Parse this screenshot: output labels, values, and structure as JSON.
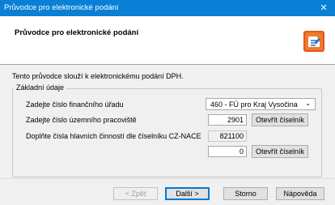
{
  "window": {
    "title": "Průvodce pro elektronické podání",
    "close_glyph": "✕"
  },
  "header": {
    "title": "Průvodce pro elektronické podání",
    "logo_icon": "wizard-logo"
  },
  "intro": "Tento průvodce slouží k elektronickému podání DPH.",
  "group": {
    "label": "Základní údaje",
    "office_label": "Zadejte číslo finančního úřadu",
    "office_value": "460 - FÚ pro Kraj Vysočina",
    "workplace_label": "Zadejte číslo územního pracoviště",
    "workplace_value": "2901",
    "open_register_1": "Otevřít číselník",
    "nace_label": "Doplňte čísla hlavních činností dle číselníku CZ-NACE",
    "nace_value": "821100",
    "nace_extra_value": "0",
    "open_register_2": "Otevřít číselník"
  },
  "buttons": {
    "back": "< Zpět",
    "next": "Další >",
    "cancel": "Storno",
    "help": "Nápověda"
  },
  "colors": {
    "titlebar": "#0a7fd6",
    "logo_orange": "#e8561c",
    "logo_blue": "#2a6ebd"
  }
}
